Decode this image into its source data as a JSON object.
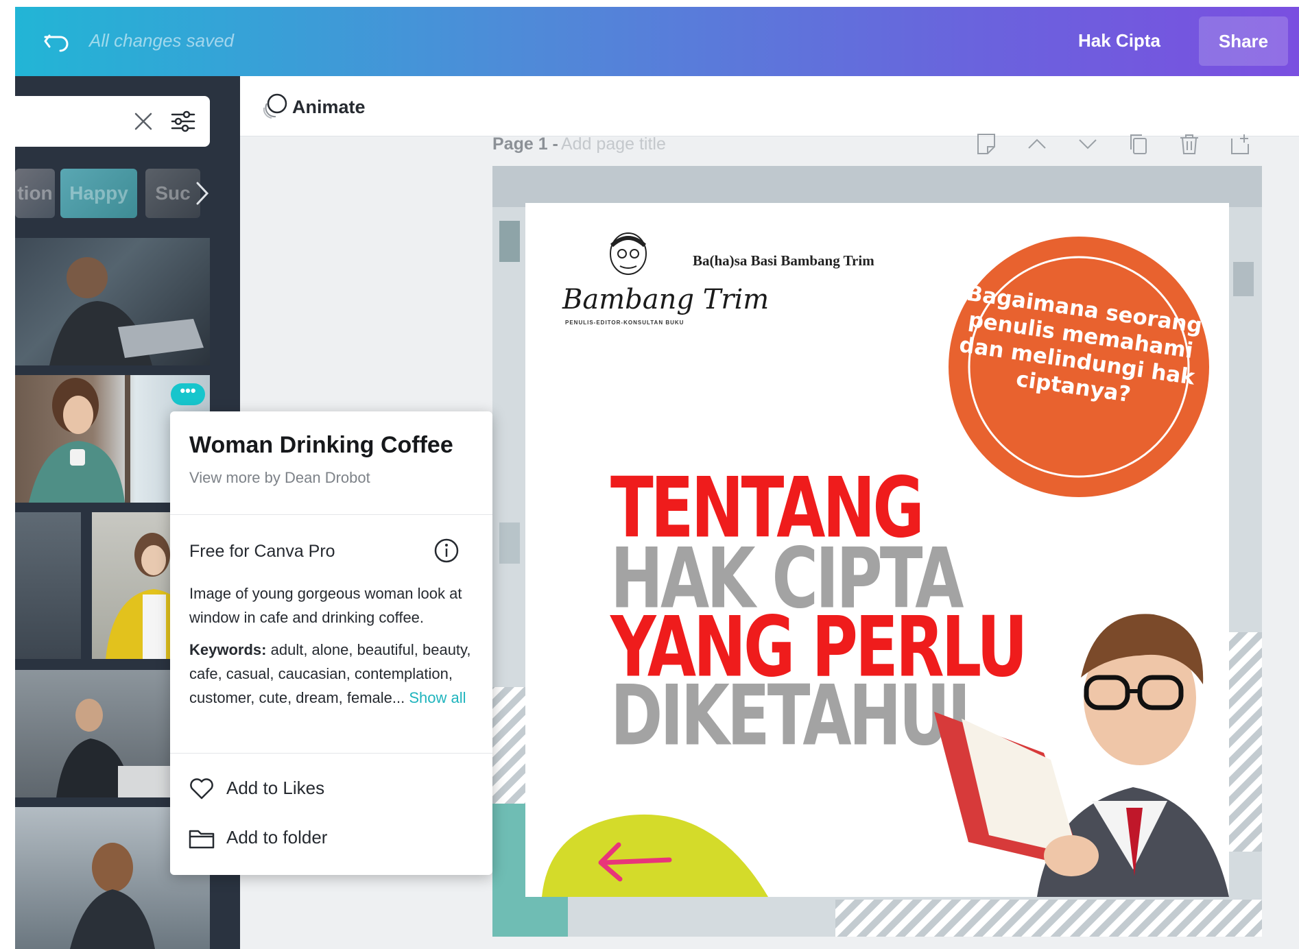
{
  "header": {
    "status": "All changes saved",
    "hak_cipta_label": "Hak Cipta",
    "share_label": "Share"
  },
  "left_panel": {
    "search": {
      "value": "",
      "placeholder": ""
    },
    "chips": [
      "tion",
      "Happy",
      "Suc"
    ]
  },
  "editor": {
    "animate_label": "Animate",
    "page_label": "Page 1 -",
    "page_title_placeholder": "Add page title"
  },
  "design": {
    "brand_name": "Ba(ha)sa Basi Bambang Trim",
    "brand_signature": "Bambang Trim",
    "brand_tagline": "PENULIS-EDITOR-KONSULTAN BUKU",
    "badge_text": "Bagaimana seorang penulis memahami dan melindungi hak ciptanya?",
    "headline": [
      "TENTANG",
      "HAK CIPTA",
      "YANG PERLU",
      "DIKETAHUI"
    ],
    "colors": {
      "red": "#ef1c1c",
      "gray": "#a3a3a3",
      "orange": "#e8622f",
      "lime": "#d4db2a",
      "teal": "#6fbdb4",
      "pink": "#e8357a"
    }
  },
  "popup": {
    "title": "Woman Drinking Coffee",
    "author_link": "View more by Dean Drobot",
    "license": "Free for Canva Pro",
    "description": "Image of young gorgeous woman look at window in cafe and drinking coffee.",
    "keywords_label": "Keywords:",
    "keywords": "adult, alone, beautiful, beauty, cafe, casual, caucasian, contemplation, customer, cute, dream, female...",
    "show_all": "Show all",
    "add_likes": "Add to Likes",
    "add_folder": "Add to folder"
  },
  "theme": {
    "header_gradient": [
      "#22b5d6",
      "#7a4fe0"
    ],
    "panel_bg": "#2a3340",
    "accent": "#17c5cc"
  }
}
